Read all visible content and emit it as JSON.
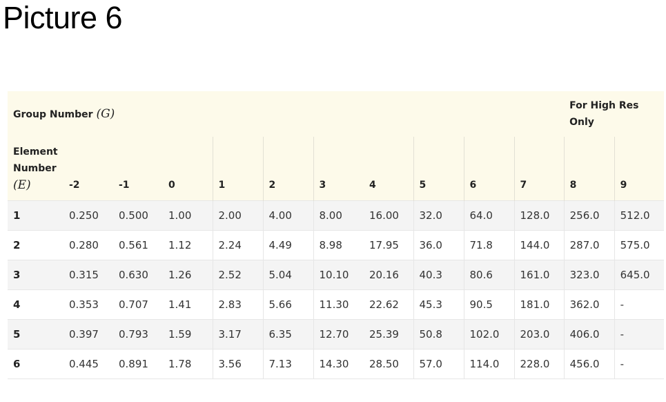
{
  "title": "Picture 6",
  "table": {
    "group_header": {
      "label": "Group Number",
      "variable": "(G)",
      "high_res_note": "For High Res Only"
    },
    "element_header": {
      "label": "Element Number",
      "variable": "(E)"
    },
    "groups": [
      "-2",
      "-1",
      "0",
      "1",
      "2",
      "3",
      "4",
      "5",
      "6",
      "7",
      "8",
      "9"
    ],
    "rows": [
      {
        "element": "1",
        "values": [
          "0.250",
          "0.500",
          "1.00",
          "2.00",
          "4.00",
          "8.00",
          "16.00",
          "32.0",
          "64.0",
          "128.0",
          "256.0",
          "512.0"
        ]
      },
      {
        "element": "2",
        "values": [
          "0.280",
          "0.561",
          "1.12",
          "2.24",
          "4.49",
          "8.98",
          "17.95",
          "36.0",
          "71.8",
          "144.0",
          "287.0",
          "575.0"
        ]
      },
      {
        "element": "3",
        "values": [
          "0.315",
          "0.630",
          "1.26",
          "2.52",
          "5.04",
          "10.10",
          "20.16",
          "40.3",
          "80.6",
          "161.0",
          "323.0",
          "645.0"
        ]
      },
      {
        "element": "4",
        "values": [
          "0.353",
          "0.707",
          "1.41",
          "2.83",
          "5.66",
          "11.30",
          "22.62",
          "45.3",
          "90.5",
          "181.0",
          "362.0",
          "-"
        ]
      },
      {
        "element": "5",
        "values": [
          "0.397",
          "0.793",
          "1.59",
          "3.17",
          "6.35",
          "12.70",
          "25.39",
          "50.8",
          "102.0",
          "203.0",
          "406.0",
          "-"
        ]
      },
      {
        "element": "6",
        "values": [
          "0.445",
          "0.891",
          "1.78",
          "3.56",
          "7.13",
          "14.30",
          "28.50",
          "57.0",
          "114.0",
          "228.0",
          "456.0",
          "-"
        ]
      }
    ]
  }
}
